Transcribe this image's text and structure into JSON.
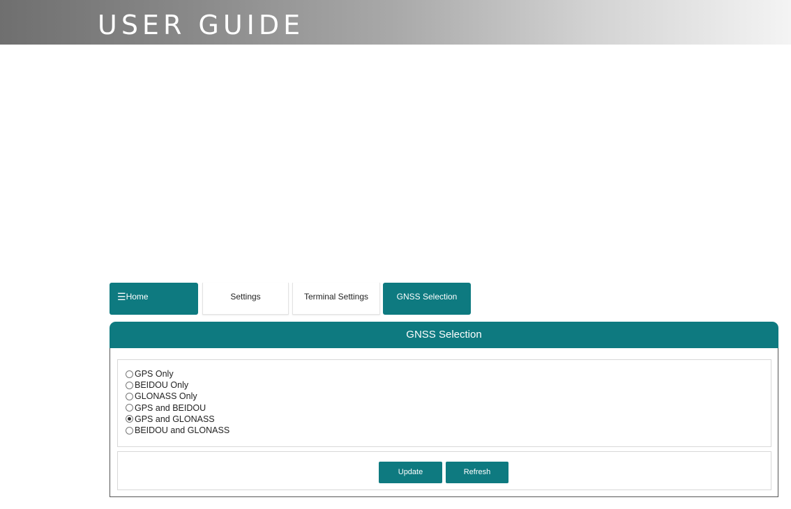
{
  "banner": {
    "title": "USER GUIDE"
  },
  "breadcrumbs": [
    {
      "label": "Home",
      "icon": "menu-icon"
    },
    {
      "label": "Settings"
    },
    {
      "label": "Terminal Settings"
    },
    {
      "label": "GNSS Selection"
    }
  ],
  "panel": {
    "title": "GNSS Selection",
    "options": [
      {
        "label": "GPS Only",
        "selected": false
      },
      {
        "label": "BEIDOU Only",
        "selected": false
      },
      {
        "label": "GLONASS Only",
        "selected": false
      },
      {
        "label": "GPS and BEIDOU",
        "selected": false
      },
      {
        "label": "GPS and GLONASS",
        "selected": true
      },
      {
        "label": "BEIDOU and GLONASS",
        "selected": false
      }
    ],
    "buttons": {
      "update": "Update",
      "refresh": "Refresh"
    }
  },
  "colors": {
    "accent": "#0e7a80"
  }
}
